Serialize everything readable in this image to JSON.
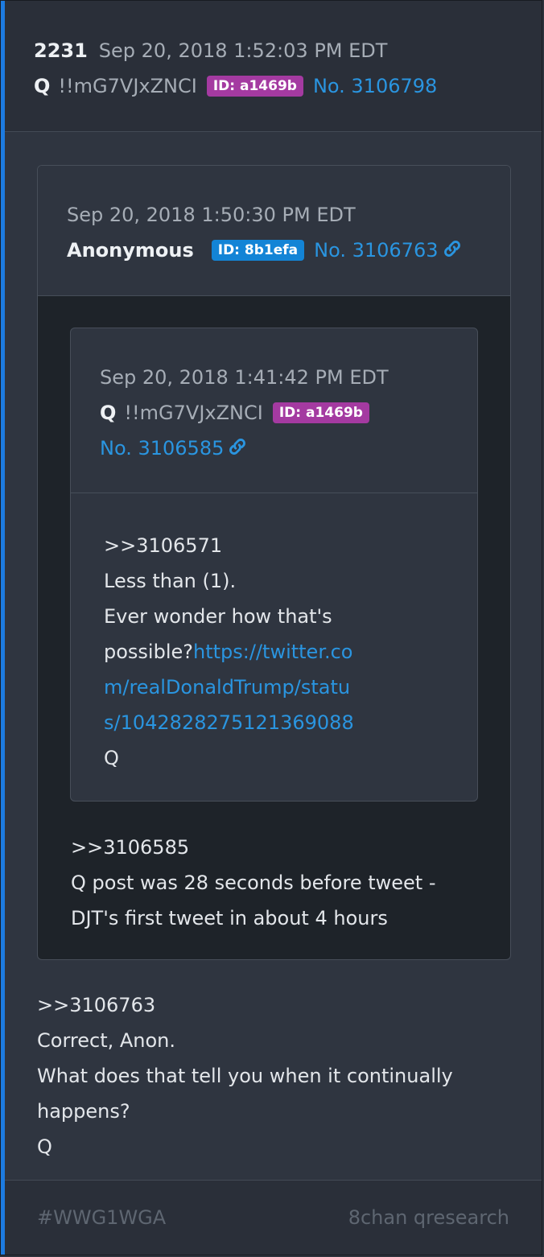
{
  "post": {
    "number": "2231",
    "date": "Sep 20, 2018 1:52:03 PM EDT",
    "name": "Q",
    "tripcode": "!!mG7VJxZNCI",
    "id_badge": "ID: a1469b",
    "post_no": "No. 3106798",
    "body": [
      ">>3106763",
      "Correct, Anon.",
      "What does that tell you when it continually",
      "happens?",
      "Q"
    ]
  },
  "quote1": {
    "date": "Sep 20, 2018 1:50:30 PM EDT",
    "name": "Anonymous",
    "id_badge": "ID: 8b1efa",
    "post_no": "No. 3106763",
    "body": [
      ">>3106585",
      "Q post was 28 seconds before tweet -",
      "DJT's first tweet in about 4 hours"
    ]
  },
  "quote2": {
    "date": "Sep 20, 2018 1:41:42 PM EDT",
    "name": "Q",
    "tripcode": "!!mG7VJxZNCI",
    "id_badge": "ID: a1469b",
    "post_no": "No. 3106585",
    "body_line1": ">>3106571",
    "body_line2": "Less than (1).",
    "body_line3": "Ever wonder how that's",
    "body_line4_text": "possible?",
    "url_part1": "https://twitter.co",
    "url_part2": "m/realDonaldTrump/statu",
    "url_part3": "s/1042828275121369088",
    "body_line7": "Q"
  },
  "footer": {
    "hashtag": "#WWG1WGA",
    "source": "8chan qresearch"
  },
  "colors": {
    "accent": "#1d7be0",
    "link": "#2a95e0",
    "badge_purple": "#a43aa1",
    "badge_blue": "#1384d6"
  },
  "icons": [
    "link-icon"
  ]
}
